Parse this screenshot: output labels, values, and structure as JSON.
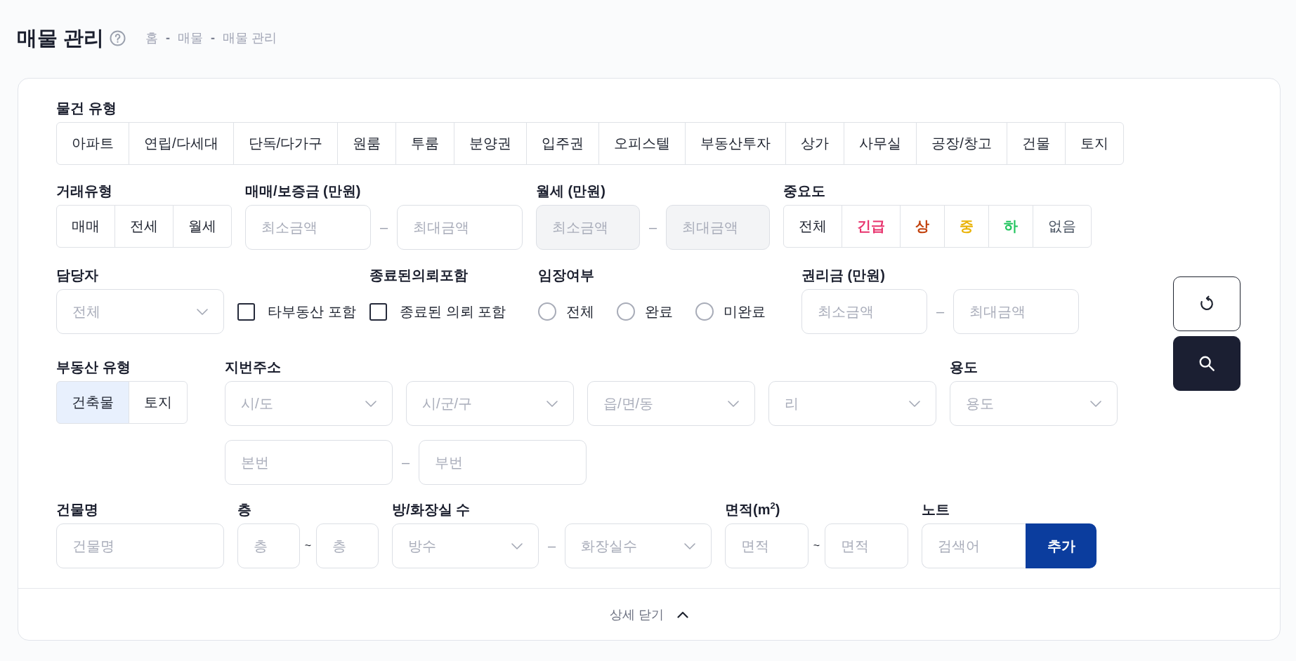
{
  "header": {
    "title": "매물 관리",
    "breadcrumb": [
      {
        "kind": "link",
        "text": "홈"
      },
      {
        "kind": "separator",
        "text": "-"
      },
      {
        "kind": "link",
        "text": "매물"
      },
      {
        "kind": "separator",
        "text": "-"
      },
      {
        "kind": "current",
        "text": "매물 관리"
      }
    ]
  },
  "filters": {
    "property_type": {
      "label": "물건 유형",
      "options": [
        {
          "label": "아파트",
          "selected": false
        },
        {
          "label": "연립/다세대",
          "selected": false
        },
        {
          "label": "단독/다가구",
          "selected": false
        },
        {
          "label": "원룸",
          "selected": false
        },
        {
          "label": "투룸",
          "selected": false
        },
        {
          "label": "분양권",
          "selected": false
        },
        {
          "label": "입주권",
          "selected": false
        },
        {
          "label": "오피스텔",
          "selected": false
        },
        {
          "label": "부동산투자",
          "selected": false
        },
        {
          "label": "상가",
          "selected": false
        },
        {
          "label": "사무실",
          "selected": false
        },
        {
          "label": "공장/창고",
          "selected": false
        },
        {
          "label": "건물",
          "selected": false
        },
        {
          "label": "토지",
          "selected": false
        }
      ]
    },
    "deal_type": {
      "label": "거래유형",
      "options": [
        {
          "label": "매매",
          "selected": false
        },
        {
          "label": "전세",
          "selected": false
        },
        {
          "label": "월세",
          "selected": false
        }
      ]
    },
    "price": {
      "label": "매매/보증금 (만원)",
      "disabled": false,
      "min": {
        "placeholder": "최소금액"
      },
      "separator": "–",
      "max": {
        "placeholder": "최대금액"
      }
    },
    "monthly_rent": {
      "label": "월세 (만원)",
      "disabled": true,
      "min": {
        "placeholder": "최소금액"
      },
      "separator": "–",
      "max": {
        "placeholder": "최대금액"
      }
    },
    "importance": {
      "label": "중요도",
      "options": [
        {
          "label": "전체",
          "kind": "all",
          "color": "#1f2430",
          "selected": false
        },
        {
          "label": "긴급",
          "kind": "level",
          "color": "#e8336d",
          "selected": false
        },
        {
          "label": "상",
          "kind": "level",
          "color": "#c2410c",
          "selected": false
        },
        {
          "label": "중",
          "kind": "level",
          "color": "#eab308",
          "selected": false
        },
        {
          "label": "하",
          "kind": "level",
          "color": "#22c55e",
          "selected": false
        },
        {
          "label": "없음",
          "kind": "none",
          "color": "#4b5563",
          "selected": false
        }
      ]
    },
    "agent": {
      "label": "담당자",
      "placeholder": "전체"
    },
    "other_agencies": {
      "label": "타부동산 포함",
      "checked": false
    },
    "closed_requests": {
      "label": "종료된의뢰포함",
      "option": {
        "label": "종료된 의뢰 포함",
        "checked": false
      }
    },
    "site_visit": {
      "label": "임장여부",
      "options": [
        {
          "label": "전체",
          "selected": false
        },
        {
          "label": "완료",
          "selected": false
        },
        {
          "label": "미완료",
          "selected": false
        }
      ]
    },
    "premium": {
      "label": "권리금 (만원)",
      "disabled": false,
      "min": {
        "placeholder": "최소금액"
      },
      "separator": "–",
      "max": {
        "placeholder": "최대금액"
      }
    },
    "building_kind": {
      "label": "부동산 유형",
      "options": [
        {
          "label": "건축물",
          "selected": true
        },
        {
          "label": "토지",
          "selected": false
        }
      ]
    },
    "lot_address": {
      "label": "지번주소",
      "selects": [
        {
          "placeholder": "시/도"
        },
        {
          "placeholder": "시/군/구"
        },
        {
          "placeholder": "읍/면/동"
        },
        {
          "placeholder": "리"
        }
      ],
      "main_number": {
        "placeholder": "본번"
      },
      "separator": "–",
      "sub_number": {
        "placeholder": "부번"
      }
    },
    "usage": {
      "label": "용도",
      "placeholder": "용도"
    },
    "building_name": {
      "label": "건물명",
      "placeholder": "건물명"
    },
    "floor": {
      "label": "층",
      "min": {
        "placeholder": "층"
      },
      "separator": "~",
      "max": {
        "placeholder": "층"
      }
    },
    "rooms": {
      "label": "방/화장실 수",
      "rooms": {
        "placeholder": "방수"
      },
      "separator": "–",
      "bathrooms": {
        "placeholder": "화장실수"
      }
    },
    "area": {
      "label": "면적(m$^{2}$)",
      "min": {
        "placeholder": "면적"
      },
      "separator": "~",
      "max": {
        "placeholder": "면적"
      }
    },
    "note": {
      "label": "노트",
      "placeholder": "검색어",
      "button": "추가"
    }
  },
  "actions": [
    {
      "kind": "reset"
    },
    {
      "kind": "search"
    }
  ],
  "toggle": {
    "label": "상세 닫기",
    "expanded": true
  }
}
